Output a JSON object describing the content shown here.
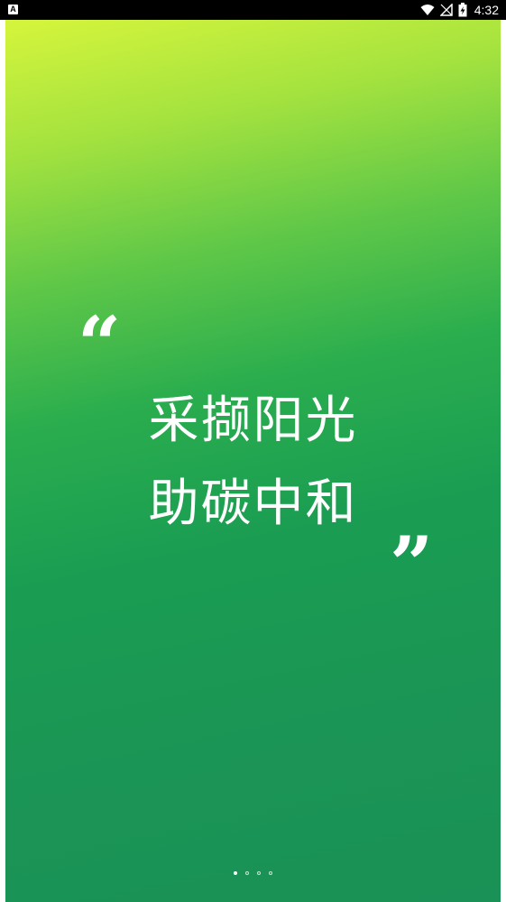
{
  "status_bar": {
    "notification_icon_text": "A",
    "time": "4:32",
    "icons": [
      "wifi-icon",
      "signal-icon",
      "battery-charging-icon"
    ]
  },
  "splash": {
    "quote_open": "“",
    "slogan_line1": "采撷阳光",
    "slogan_line2": "助碳中和",
    "quote_close": "”",
    "page_count": 4,
    "active_page": 1,
    "colors": {
      "gradient_top": "#d6f53c",
      "gradient_mid": "#2aad4e",
      "gradient_bottom": "#1a9156",
      "text": "#ffffff"
    }
  }
}
